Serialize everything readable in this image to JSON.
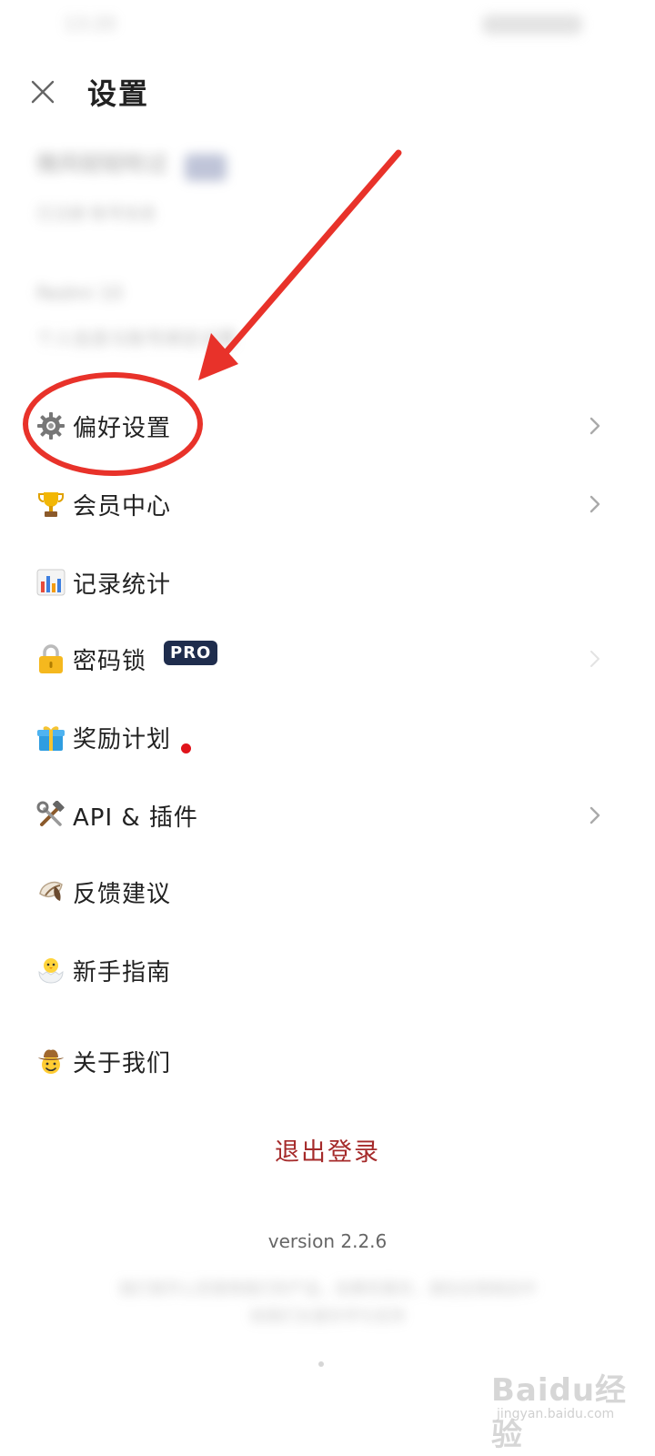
{
  "status_bar": {
    "time": "13:20"
  },
  "header": {
    "title": "设置"
  },
  "account": {
    "name": "微风轻轻吹过",
    "subtitle": "已注册·账号信息"
  },
  "device": {
    "name": "Redmi 10",
    "subtitle": "个人信息与账号绑定设置"
  },
  "menu": [
    {
      "icon": "gear-icon",
      "label": "偏好设置",
      "chevron": true
    },
    {
      "icon": "trophy-icon",
      "label": "会员中心",
      "chevron": true
    },
    {
      "icon": "bar-chart-icon",
      "label": "记录统计",
      "chevron": false
    },
    {
      "icon": "lock-icon",
      "label": "密码锁",
      "chevron": true,
      "badge": "PRO"
    },
    {
      "icon": "gift-icon",
      "label": "奖励计划",
      "chevron": false,
      "dot": true
    },
    {
      "icon": "tools-icon",
      "label": "API & 插件",
      "chevron": true
    },
    {
      "icon": "shell-icon",
      "label": "反馈建议",
      "chevron": false
    },
    {
      "icon": "chick-icon",
      "label": "新手指南",
      "chevron": false
    },
    {
      "icon": "cowboy-icon",
      "label": "关于我们",
      "chevron": false
    }
  ],
  "logout_label": "退出登录",
  "version": "version 2.2.6",
  "footer_note": "我们很开心您使用我们的产品，如果您喜欢，请在应用商店中给我们五星好评与支持",
  "watermark": {
    "brand": "Baidu经验",
    "url": "jingyan.baidu.com"
  },
  "colors": {
    "annotation": "#e8322a",
    "logout": "#a52a2a",
    "pro_badge": "#1f2d4d",
    "red_dot": "#e0141b"
  }
}
